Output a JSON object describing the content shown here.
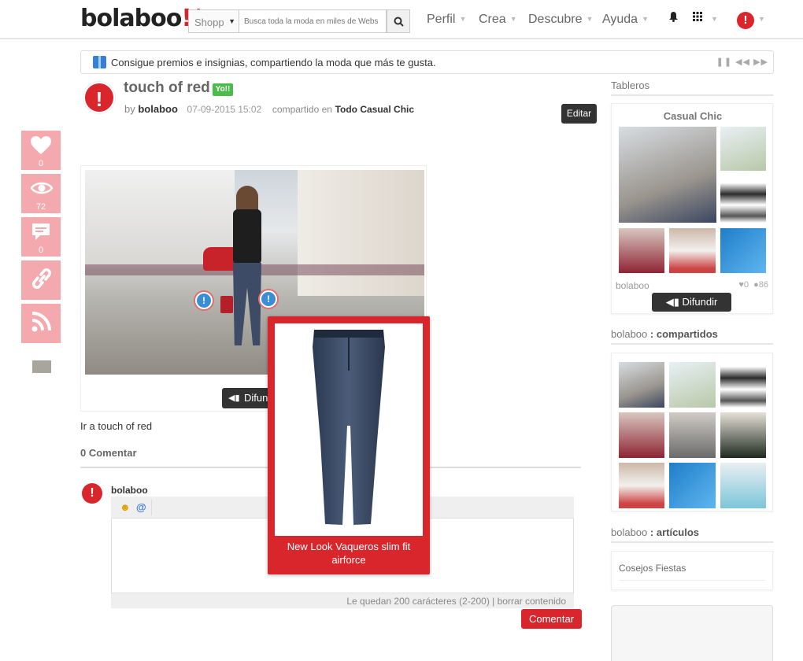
{
  "header": {
    "logo_text": "bolaboo",
    "logo_mark": "!/",
    "shop_select": "Shopp",
    "search_placeholder": "Busca toda la moda en miles de Webs",
    "nav": [
      "Perfil",
      "Crea",
      "Descubre",
      "Ayuda"
    ]
  },
  "tipbar": {
    "text": "Consigue premios e insignias, compartiendo la moda que más te gusta.",
    "controls": "❚❚ ◀◀ ▶▶"
  },
  "social": {
    "likes": "0",
    "views": "72",
    "comments": "0"
  },
  "post": {
    "title": "touch of red",
    "badge": "Yo!!",
    "by": "by",
    "author": "bolaboo",
    "date": "07-09-2015 15:02",
    "shared_in": "compartido en",
    "board": "Todo Casual Chic",
    "edit_label": "Editar",
    "difundir_label": "Difundir",
    "description": "Ir a touch of red"
  },
  "comments": {
    "count_label": "0 Comentar",
    "user": "bolaboo",
    "status": "Le quedan 200 carácteres (2-200) | borrar contenido",
    "submit_label": "Comentar"
  },
  "popup": {
    "product_name": "New Look Vaqueros slim fit airforce"
  },
  "sidebar": {
    "boards_title": "Tableros",
    "board_name": "Casual Chic",
    "board_owner": "bolaboo",
    "board_likes": "0",
    "board_comments": "86",
    "difundir_label": "Difundir",
    "shared_user": "bolaboo",
    "shared_suffix": ": compartidos",
    "articles_user": "bolaboo",
    "articles_suffix": ": artículos",
    "article_item": "Cosejos Fiestas"
  },
  "colors": {
    "brand_red": "#d9262c",
    "social_pink": "#f4a9ae",
    "dark_button": "#333333"
  }
}
